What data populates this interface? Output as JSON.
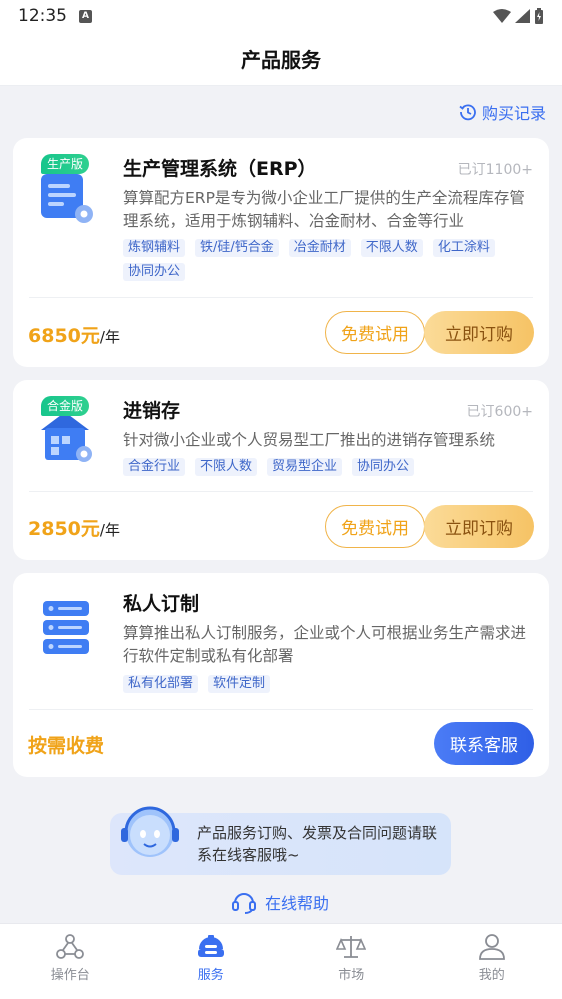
{
  "status": {
    "time": "12:35"
  },
  "header": {
    "title": "产品服务"
  },
  "history": {
    "label": "购买记录"
  },
  "products": [
    {
      "badge": "生产版",
      "name": "生产管理系统（ERP）",
      "sold": "已订1100+",
      "desc": "算算配方ERP是专为微小企业工厂提供的生产全流程库存管理系统，适用于炼钢辅料、冶金耐材、合金等行业",
      "tags": [
        "炼钢辅料",
        "铁/硅/钙合金",
        "冶金耐材",
        "不限人数",
        "化工涂料",
        "协同办公"
      ],
      "price": "6850元",
      "unit": "/年",
      "trial_label": "免费试用",
      "buy_label": "立即订购"
    },
    {
      "badge": "合金版",
      "name": "进销存",
      "sold": "已订600+",
      "desc": "针对微小企业或个人贸易型工厂推出的进销存管理系统",
      "tags": [
        "合金行业",
        "不限人数",
        "贸易型企业",
        "协同办公"
      ],
      "price": "2850元",
      "unit": "/年",
      "trial_label": "免费试用",
      "buy_label": "立即订购"
    },
    {
      "name": "私人订制",
      "desc": "算算推出私人订制服务，企业或个人可根据业务生产需求进行软件定制或私有化部署",
      "tags": [
        "私有化部署",
        "软件定制"
      ],
      "price": "按需收费",
      "contact_label": "联系客服"
    }
  ],
  "help": {
    "bubble": "产品服务订购、发票及合同问题请联系在线客服哦~",
    "online": "在线帮助"
  },
  "tabs": [
    {
      "label": "操作台",
      "icon": "workbench-icon"
    },
    {
      "label": "服务",
      "icon": "service-icon",
      "active": true
    },
    {
      "label": "市场",
      "icon": "scale-icon"
    },
    {
      "label": "我的",
      "icon": "user-icon"
    }
  ],
  "colors": {
    "accent": "#3a6ff0",
    "price": "#f0a319",
    "green_badge": "#17c58c"
  }
}
